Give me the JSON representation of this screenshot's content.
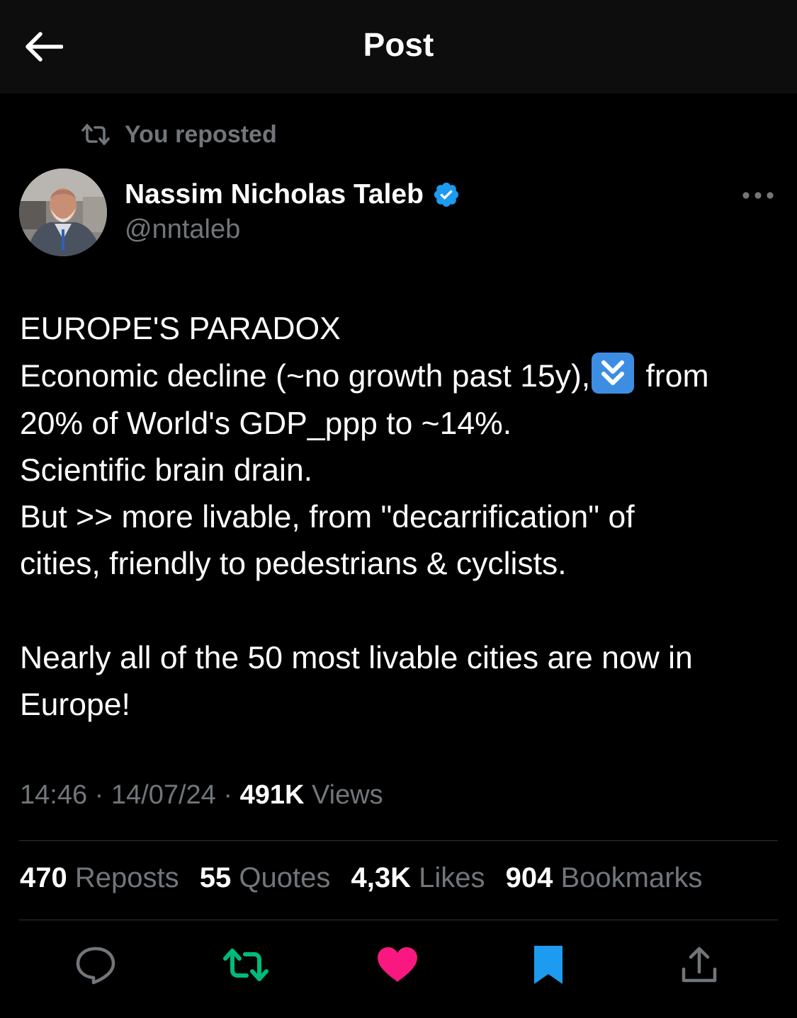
{
  "header": {
    "title": "Post"
  },
  "repost": {
    "label": "You reposted"
  },
  "author": {
    "name": "Nassim Nicholas Taleb",
    "handle": "@nntaleb"
  },
  "post": {
    "lines": [
      "EUROPE'S PARADOX",
      "Economic decline (~no growth past 15y),",
      "from",
      "20% of World's GDP_ppp to ~14%.",
      "Scientific brain drain.",
      "But >> more livable, from \"decarrification\" of",
      "cities, friendly to pedestrians & cyclists.",
      "Nearly all of the 50 most livable cities are now in",
      "Europe!"
    ]
  },
  "meta": {
    "time": "14:46",
    "date": "14/07/24",
    "views_count": "491K",
    "views_label": "Views",
    "separator": "·"
  },
  "stats": [
    {
      "count": "470",
      "label": "Reposts"
    },
    {
      "count": "55",
      "label": "Quotes"
    },
    {
      "count": "4,3K",
      "label": "Likes"
    },
    {
      "count": "904",
      "label": "Bookmarks"
    }
  ],
  "colors": {
    "background": "#000000",
    "header_background": "#0d0d0d",
    "text_primary": "#ffffff",
    "text_secondary": "#71767b",
    "verified_blue": "#1d9bf0",
    "repost_green": "#00ba7c",
    "like_pink": "#f91880",
    "bookmark_blue": "#1d9bf0",
    "divider": "#2f3336"
  },
  "icons": {
    "back": "arrow-left-icon",
    "repost": "repost-icon",
    "verified": "verified-badge-icon",
    "more": "more-horizontal-icon",
    "emoji": "double-down-arrow-emoji",
    "reply": "reply-icon",
    "like": "heart-icon",
    "bookmark": "bookmark-icon",
    "share": "share-icon"
  }
}
